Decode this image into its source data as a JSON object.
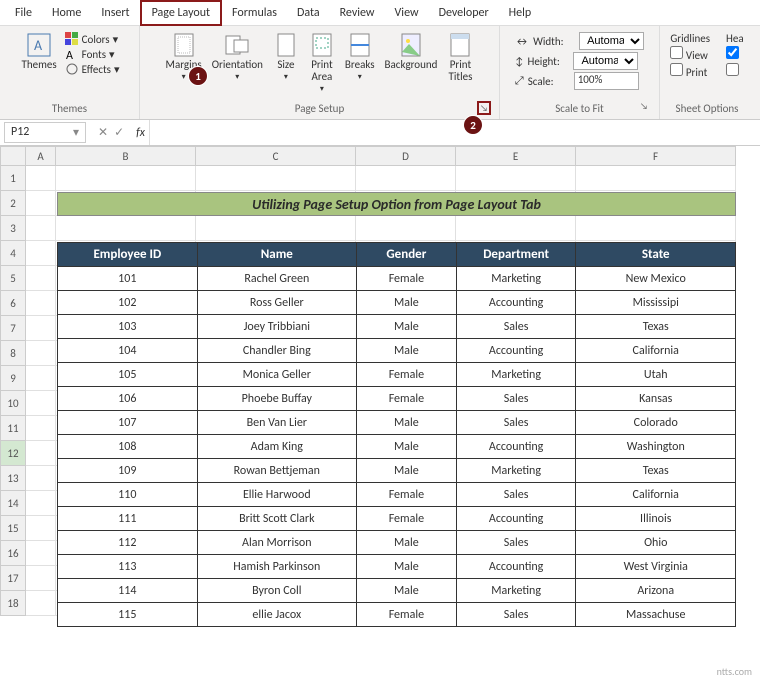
{
  "tabs": [
    "File",
    "Home",
    "Insert",
    "Page Layout",
    "Formulas",
    "Data",
    "Review",
    "View",
    "Developer",
    "Help"
  ],
  "active_tab": "Page Layout",
  "ribbon": {
    "themes": {
      "main": "Themes",
      "colors": "Colors",
      "fonts": "Fonts",
      "effects": "Effects",
      "label": "Themes"
    },
    "page_setup": {
      "margins": "Margins",
      "orientation": "Orientation",
      "size": "Size",
      "print_area": "Print\nArea",
      "breaks": "Breaks",
      "background": "Background",
      "print_titles": "Print\nTitles",
      "label": "Page Setup"
    },
    "scale": {
      "width_label": "Width:",
      "width_value": "Automatic",
      "height_label": "Height:",
      "height_value": "Automatic",
      "scale_label": "Scale:",
      "scale_value": "100%",
      "label": "Scale to Fit"
    },
    "sheet_opts": {
      "gridlines": "Gridlines",
      "headings": "Hea",
      "view": "View",
      "print": "Print",
      "label": "Sheet Options"
    }
  },
  "callouts": {
    "c1": "1",
    "c2": "2"
  },
  "namebox": "P12",
  "columns": [
    "A",
    "B",
    "C",
    "D",
    "E",
    "F"
  ],
  "row_count": 18,
  "selected_row": 12,
  "banner": "Utilizing Page Setup Option from Page Layout Tab",
  "table": {
    "headers": [
      "Employee ID",
      "Name",
      "Gender",
      "Department",
      "State"
    ],
    "rows": [
      [
        "101",
        "Rachel Green",
        "Female",
        "Marketing",
        "New Mexico"
      ],
      [
        "102",
        "Ross Geller",
        "Male",
        "Accounting",
        "Mississipi"
      ],
      [
        "103",
        "Joey Tribbiani",
        "Male",
        "Sales",
        "Texas"
      ],
      [
        "104",
        "Chandler Bing",
        "Male",
        "Accounting",
        "California"
      ],
      [
        "105",
        "Monica Geller",
        "Female",
        "Marketing",
        "Utah"
      ],
      [
        "106",
        "Phoebe Buffay",
        "Female",
        "Sales",
        "Kansas"
      ],
      [
        "107",
        "Ben Van Lier",
        "Male",
        "Sales",
        "Colorado"
      ],
      [
        "108",
        "Adam King",
        "Male",
        "Accounting",
        "Washington"
      ],
      [
        "109",
        "Rowan Bettjeman",
        "Male",
        "Marketing",
        "Texas"
      ],
      [
        "110",
        "Ellie Harwood",
        "Female",
        "Sales",
        "California"
      ],
      [
        "111",
        "Britt Scott Clark",
        "Female",
        "Accounting",
        "Illinois"
      ],
      [
        "112",
        "Alan Morrison",
        "Male",
        "Sales",
        "Ohio"
      ],
      [
        "113",
        "Hamish Parkinson",
        "Male",
        "Accounting",
        "West Virginia"
      ],
      [
        "114",
        "Byron Coll",
        "Male",
        "Marketing",
        "Arizona"
      ],
      [
        "115",
        "ellie Jacox",
        "Female",
        "Sales",
        "Massachuse"
      ]
    ]
  },
  "watermark": "ntts.com"
}
